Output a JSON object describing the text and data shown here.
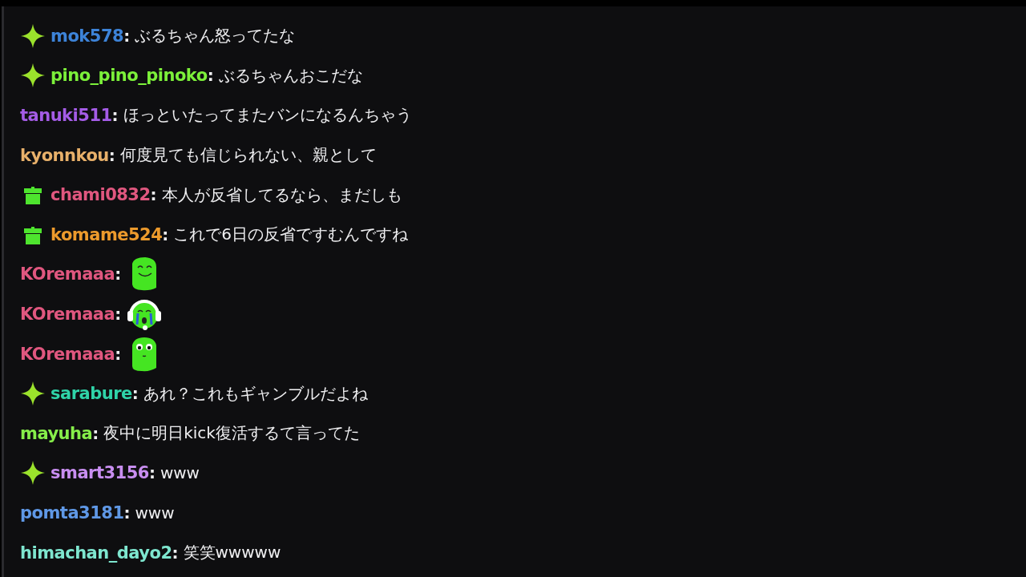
{
  "messages": [
    {
      "badge": {
        "kind": "sparkle"
      },
      "name": "mok578",
      "color": "#3d83d8",
      "separator": ":",
      "kind": "text",
      "text": "ぶるちゃん怒ってたな"
    },
    {
      "badge": {
        "kind": "sparkle"
      },
      "name": "pino_pino_pinoko",
      "color": "#7cf03a",
      "separator": ":",
      "kind": "text",
      "text": "ぶるちゃんおこだな"
    },
    {
      "name": "tanuki511",
      "color": "#a45ce6",
      "separator": ":",
      "kind": "text",
      "text": "ほっといたってまたバンになるんちゃう"
    },
    {
      "name": "kyonnkou",
      "color": "#e8b06a",
      "separator": ":",
      "kind": "text",
      "text": "何度見ても信じられない、親として"
    },
    {
      "badge": {
        "kind": "gift"
      },
      "name": "chami0832",
      "color": "#e0577f",
      "separator": ":",
      "kind": "text",
      "text": "本人が反省してるなら、まだしも"
    },
    {
      "badge": {
        "kind": "gift"
      },
      "name": "komame524",
      "color": "#ec9a2c",
      "separator": ":",
      "kind": "text",
      "text": "これで6日の反省ですむんですね"
    },
    {
      "name": "KOremaaa",
      "color": "#e0577f",
      "separator": ":",
      "kind": "emote"
    },
    {
      "name": "KOremaaa",
      "color": "#e0577f",
      "separator": ":",
      "kind": "emote"
    },
    {
      "name": "KOremaaa",
      "color": "#e0577f",
      "separator": ":",
      "kind": "emote"
    },
    {
      "badge": {
        "kind": "sparkle"
      },
      "name": "sarabure",
      "color": "#2fd3a8",
      "separator": ":",
      "kind": "text",
      "text": "あれ？これもギャンブルだよね"
    },
    {
      "name": "mayuha",
      "color": "#86ee4a",
      "separator": ":",
      "kind": "text",
      "text": "夜中に明日kick復活するて言ってた"
    },
    {
      "badge": {
        "kind": "sparkle"
      },
      "name": "smart3156",
      "color": "#c88ef0",
      "separator": ":",
      "kind": "text",
      "text": "www"
    },
    {
      "name": "pomta3181",
      "color": "#5f98e6",
      "separator": ":",
      "kind": "text",
      "text": "www"
    },
    {
      "name": "himachan_dayo2",
      "color": "#7ee6cf",
      "separator": ":",
      "kind": "text",
      "text": "笑笑wwwww"
    }
  ]
}
